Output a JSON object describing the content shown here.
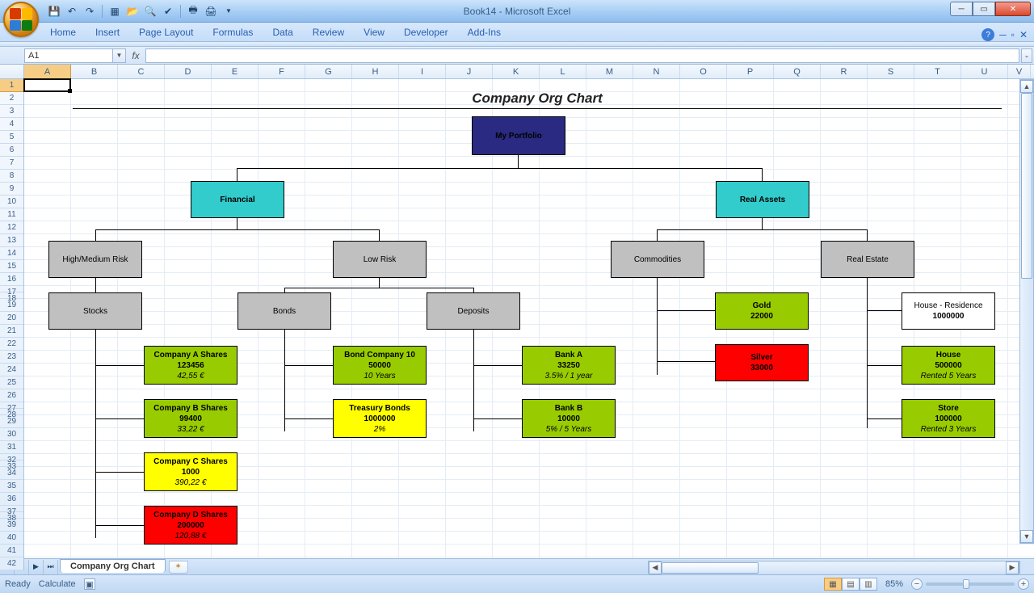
{
  "window": {
    "title": "Book14 - Microsoft Excel"
  },
  "qat_tooltips": [
    "save",
    "undo",
    "redo",
    "",
    "new",
    "open",
    "print-preview",
    "spell",
    "",
    "quick-print",
    "print"
  ],
  "ribbon": {
    "tabs": [
      "Home",
      "Insert",
      "Page Layout",
      "Formulas",
      "Data",
      "Review",
      "View",
      "Developer",
      "Add-Ins"
    ]
  },
  "namebox": {
    "ref": "A1"
  },
  "sheet": {
    "name": "Company Org Chart"
  },
  "chart_title": "Company Org Chart",
  "columns": [
    "A",
    "B",
    "C",
    "D",
    "E",
    "F",
    "G",
    "H",
    "I",
    "J",
    "K",
    "L",
    "M",
    "N",
    "O",
    "P",
    "Q",
    "R",
    "S",
    "T",
    "U",
    "V"
  ],
  "nodes": {
    "root": "My Portfolio",
    "financial": "Financial",
    "real_assets": "Real Assets",
    "high_risk": "High/Medium Risk",
    "low_risk": "Low Risk",
    "commodities": "Commodities",
    "real_estate": "Real Estate",
    "stocks": "Stocks",
    "bonds": "Bonds",
    "deposits": "Deposits",
    "gold_l1": "Gold",
    "gold_l2": "22000",
    "house_res_l1": "House - Residence",
    "house_res_l2": "1000000",
    "silver_l1": "Silver",
    "silver_l2": "33000",
    "compA_l1": "Company A Shares",
    "compA_l2": "123456",
    "compA_l3": "42,55 €",
    "compB_l1": "Company B Shares",
    "compB_l2": "99400",
    "compB_l3": "33,22 €",
    "compC_l1": "Company C Shares",
    "compC_l2": "1000",
    "compC_l3": "390,22 €",
    "compD_l1": "Company D Shares",
    "compD_l2": "200000",
    "compD_l3": "120,88 €",
    "bond10_l1": "Bond Company 10",
    "bond10_l2": "50000",
    "bond10_l3": "10 Years",
    "treas_l1": "Treasury Bonds",
    "treas_l2": "1000000",
    "treas_l3": "2%",
    "bankA_l1": "Bank A",
    "bankA_l2": "33250",
    "bankA_l3": "3.5% / 1 year",
    "bankB_l1": "Bank B",
    "bankB_l2": "10000",
    "bankB_l3": "5% / 5 Years",
    "house2_l1": "House",
    "house2_l2": "500000",
    "house2_l3": "Rented 5 Years",
    "store_l1": "Store",
    "store_l2": "100000",
    "store_l3": "Rented 3 Years"
  },
  "status": {
    "ready": "Ready",
    "calc": "Calculate",
    "zoom": "85%"
  },
  "chart_data": {
    "type": "tree",
    "title": "Company Org Chart",
    "root": {
      "label": "My Portfolio",
      "color": "navy",
      "children": [
        {
          "label": "Financial",
          "color": "cyan",
          "children": [
            {
              "label": "High/Medium Risk",
              "color": "grey",
              "children": [
                {
                  "label": "Stocks",
                  "color": "grey",
                  "children": [
                    {
                      "label": "Company A Shares",
                      "value": 123456,
                      "extra": "42,55 €",
                      "color": "green"
                    },
                    {
                      "label": "Company B Shares",
                      "value": 99400,
                      "extra": "33,22 €",
                      "color": "green"
                    },
                    {
                      "label": "Company C Shares",
                      "value": 1000,
                      "extra": "390,22 €",
                      "color": "yellow"
                    },
                    {
                      "label": "Company D Shares",
                      "value": 200000,
                      "extra": "120,88 €",
                      "color": "red"
                    }
                  ]
                }
              ]
            },
            {
              "label": "Low Risk",
              "color": "grey",
              "children": [
                {
                  "label": "Bonds",
                  "color": "grey",
                  "children": [
                    {
                      "label": "Bond Company 10",
                      "value": 50000,
                      "extra": "10 Years",
                      "color": "green"
                    },
                    {
                      "label": "Treasury Bonds",
                      "value": 1000000,
                      "extra": "2%",
                      "color": "yellow"
                    }
                  ]
                },
                {
                  "label": "Deposits",
                  "color": "grey",
                  "children": [
                    {
                      "label": "Bank A",
                      "value": 33250,
                      "extra": "3.5% / 1 year",
                      "color": "green"
                    },
                    {
                      "label": "Bank B",
                      "value": 10000,
                      "extra": "5% / 5 Years",
                      "color": "green"
                    }
                  ]
                }
              ]
            }
          ]
        },
        {
          "label": "Real Assets",
          "color": "cyan",
          "children": [
            {
              "label": "Commodities",
              "color": "grey",
              "children": [
                {
                  "label": "Gold",
                  "value": 22000,
                  "color": "green"
                },
                {
                  "label": "Silver",
                  "value": 33000,
                  "color": "red"
                }
              ]
            },
            {
              "label": "Real Estate",
              "color": "grey",
              "children": [
                {
                  "label": "House - Residence",
                  "value": 1000000,
                  "color": "white"
                },
                {
                  "label": "House",
                  "value": 500000,
                  "extra": "Rented 5 Years",
                  "color": "green"
                },
                {
                  "label": "Store",
                  "value": 100000,
                  "extra": "Rented 3 Years",
                  "color": "green"
                }
              ]
            }
          ]
        }
      ]
    }
  }
}
